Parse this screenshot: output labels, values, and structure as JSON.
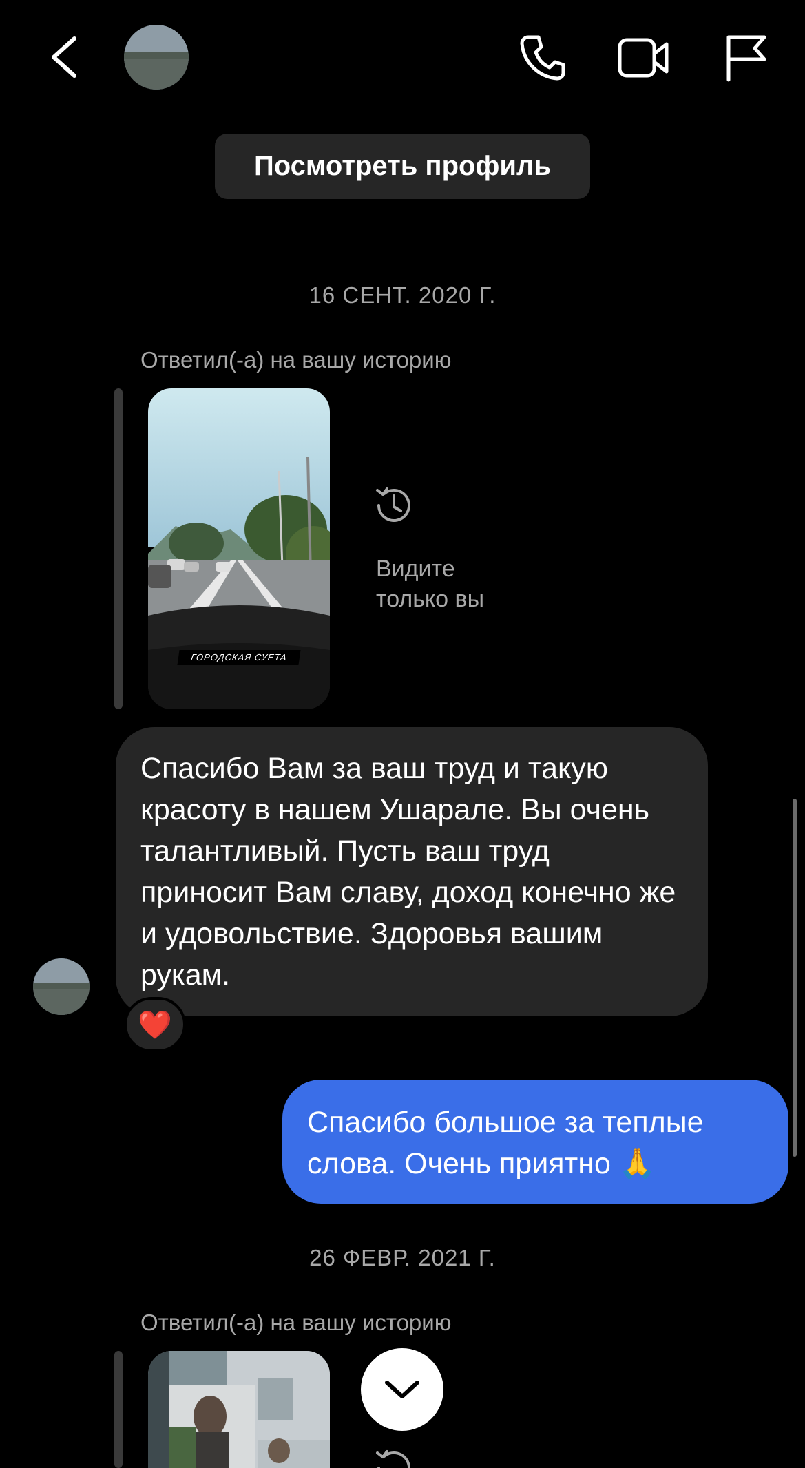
{
  "header": {
    "username": "",
    "back_icon": "chevron-left-icon",
    "call_icon": "phone-icon",
    "video_icon": "video-camera-icon",
    "flag_icon": "flag-icon"
  },
  "view_profile_label": "Посмотреть профиль",
  "conversation": {
    "date_1": "16 СЕНТ. 2020 Г.",
    "reply_label_1": "Ответил(-а) на вашу историю",
    "story_1_caption": "ГОРОДСКАЯ СУЕТА",
    "only_you_text": "Видите\nтолько вы",
    "incoming_message": "Спасибо Вам за ваш труд и такую красоту в нашем Ушарале. Вы очень талантливый. Пусть ваш труд приносит Вам славу, доход конечно же и удовольствие. Здоровья вашим рукам.",
    "reaction": "❤️",
    "outgoing_message": "Спасибо большое за теплые слова. Очень приятно 🙏",
    "date_2": "26 ФЕВР. 2021 Г.",
    "reply_label_2": "Ответил(-а) на вашу историю"
  },
  "colors": {
    "background": "#000000",
    "incoming_bubble": "#262626",
    "outgoing_bubble": "#3a6ee8",
    "secondary_text": "#a8a8a8"
  }
}
